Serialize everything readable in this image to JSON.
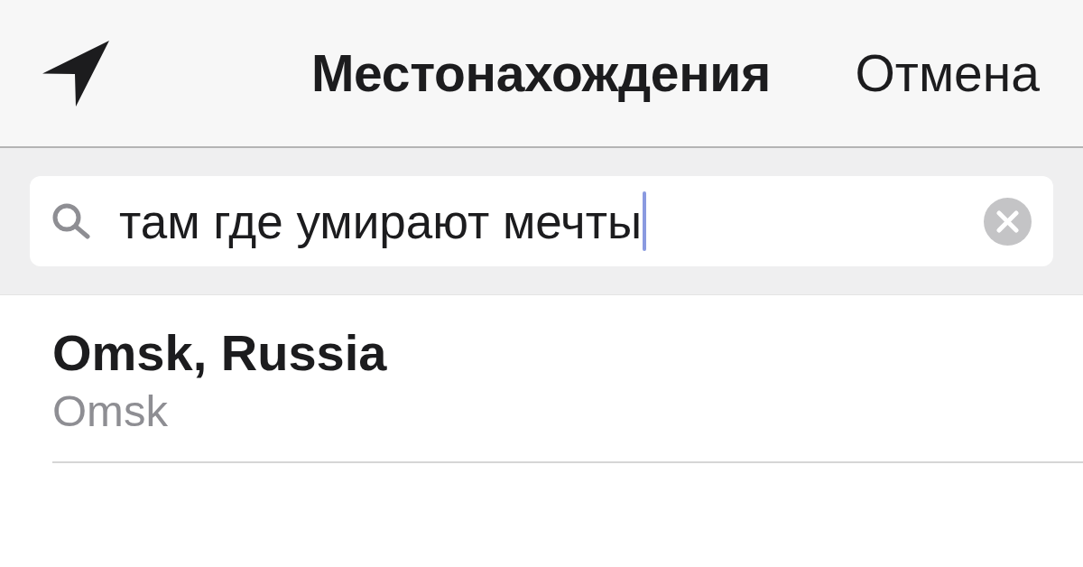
{
  "nav_bar": {
    "title": "Местонахождения",
    "cancel": "Отмена"
  },
  "search": {
    "value": "там где умирают мечты",
    "focused": true
  },
  "results": [
    {
      "title": "Omsk, Russia",
      "subtitle": "Omsk"
    }
  ]
}
